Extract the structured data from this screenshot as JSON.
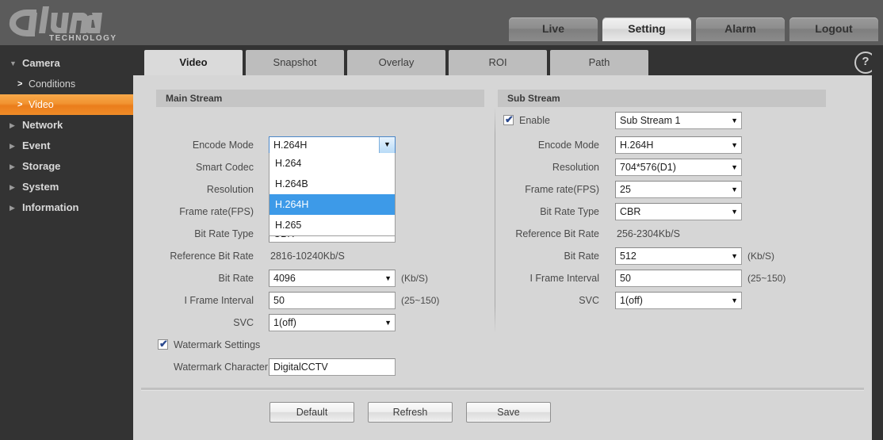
{
  "brand": {
    "name": "alhua",
    "tagline": "TECHNOLOGY"
  },
  "topnav": [
    {
      "label": "Live",
      "active": false
    },
    {
      "label": "Setting",
      "active": true
    },
    {
      "label": "Alarm",
      "active": false
    },
    {
      "label": "Logout",
      "active": false
    }
  ],
  "sidebar": [
    {
      "label": "Camera",
      "icon": "triangle-down-icon",
      "expanded": true,
      "active": false
    },
    {
      "label": "Conditions",
      "icon": "chevron-right-icon",
      "sub": true,
      "active": false
    },
    {
      "label": "Video",
      "icon": "chevron-right-icon",
      "sub": true,
      "active": true
    },
    {
      "label": "Network",
      "icon": "triangle-right-icon",
      "active": false
    },
    {
      "label": "Event",
      "icon": "triangle-right-icon",
      "active": false
    },
    {
      "label": "Storage",
      "icon": "triangle-right-icon",
      "active": false
    },
    {
      "label": "System",
      "icon": "triangle-right-icon",
      "active": false
    },
    {
      "label": "Information",
      "icon": "triangle-right-icon",
      "active": false
    }
  ],
  "tabs": [
    {
      "label": "Video",
      "active": true
    },
    {
      "label": "Snapshot",
      "active": false
    },
    {
      "label": "Overlay",
      "active": false
    },
    {
      "label": "ROI",
      "active": false
    },
    {
      "label": "Path",
      "active": false
    }
  ],
  "help": {
    "icon": "question-mark-icon",
    "label": "?"
  },
  "main_stream": {
    "title": "Main Stream",
    "encode_mode": {
      "label": "Encode Mode",
      "value": "H.264H"
    },
    "encode_mode_options": [
      "H.264",
      "H.264B",
      "H.264H",
      "H.265"
    ],
    "encode_mode_selected": "H.264H",
    "smart_codec": {
      "label": "Smart Codec"
    },
    "resolution": {
      "label": "Resolution"
    },
    "frame_rate": {
      "label": "Frame rate(FPS)"
    },
    "bit_rate_type": {
      "label": "Bit Rate Type",
      "value": "CBR"
    },
    "reference_bit_rate": {
      "label": "Reference Bit Rate",
      "value": "2816-10240Kb/S"
    },
    "bit_rate": {
      "label": "Bit Rate",
      "value": "4096",
      "unit": "(Kb/S)"
    },
    "i_frame_interval": {
      "label": "I Frame Interval",
      "value": "50",
      "unit": "(25~150)"
    },
    "svc": {
      "label": "SVC",
      "value": "1(off)"
    },
    "watermark_settings": {
      "label": "Watermark Settings",
      "checked": true,
      "mark": "✔"
    },
    "watermark_character": {
      "label": "Watermark Character",
      "value": "DigitalCCTV"
    }
  },
  "sub_stream": {
    "title": "Sub Stream",
    "enable": {
      "label": "Enable",
      "checked": true,
      "mark": "✔",
      "value": "Sub Stream 1"
    },
    "encode_mode": {
      "label": "Encode Mode",
      "value": "H.264H"
    },
    "resolution": {
      "label": "Resolution",
      "value": "704*576(D1)"
    },
    "frame_rate": {
      "label": "Frame rate(FPS)",
      "value": "25"
    },
    "bit_rate_type": {
      "label": "Bit Rate Type",
      "value": "CBR"
    },
    "reference_bit_rate": {
      "label": "Reference Bit Rate",
      "value": "256-2304Kb/S"
    },
    "bit_rate": {
      "label": "Bit Rate",
      "value": "512",
      "unit": "(Kb/S)"
    },
    "i_frame_interval": {
      "label": "I Frame Interval",
      "value": "50",
      "unit": "(25~150)"
    },
    "svc": {
      "label": "SVC",
      "value": "1(off)"
    }
  },
  "buttons": {
    "default": "Default",
    "refresh": "Refresh",
    "save": "Save"
  },
  "colors": {
    "header_bg": "#5b5b5b",
    "sidebar_bg": "#333333",
    "accent_orange": "#ee7b1e",
    "content_bg": "#d6d6d6",
    "panel_head_bg": "#c5c5c5",
    "dropdown_highlight": "#3d9ae8"
  }
}
